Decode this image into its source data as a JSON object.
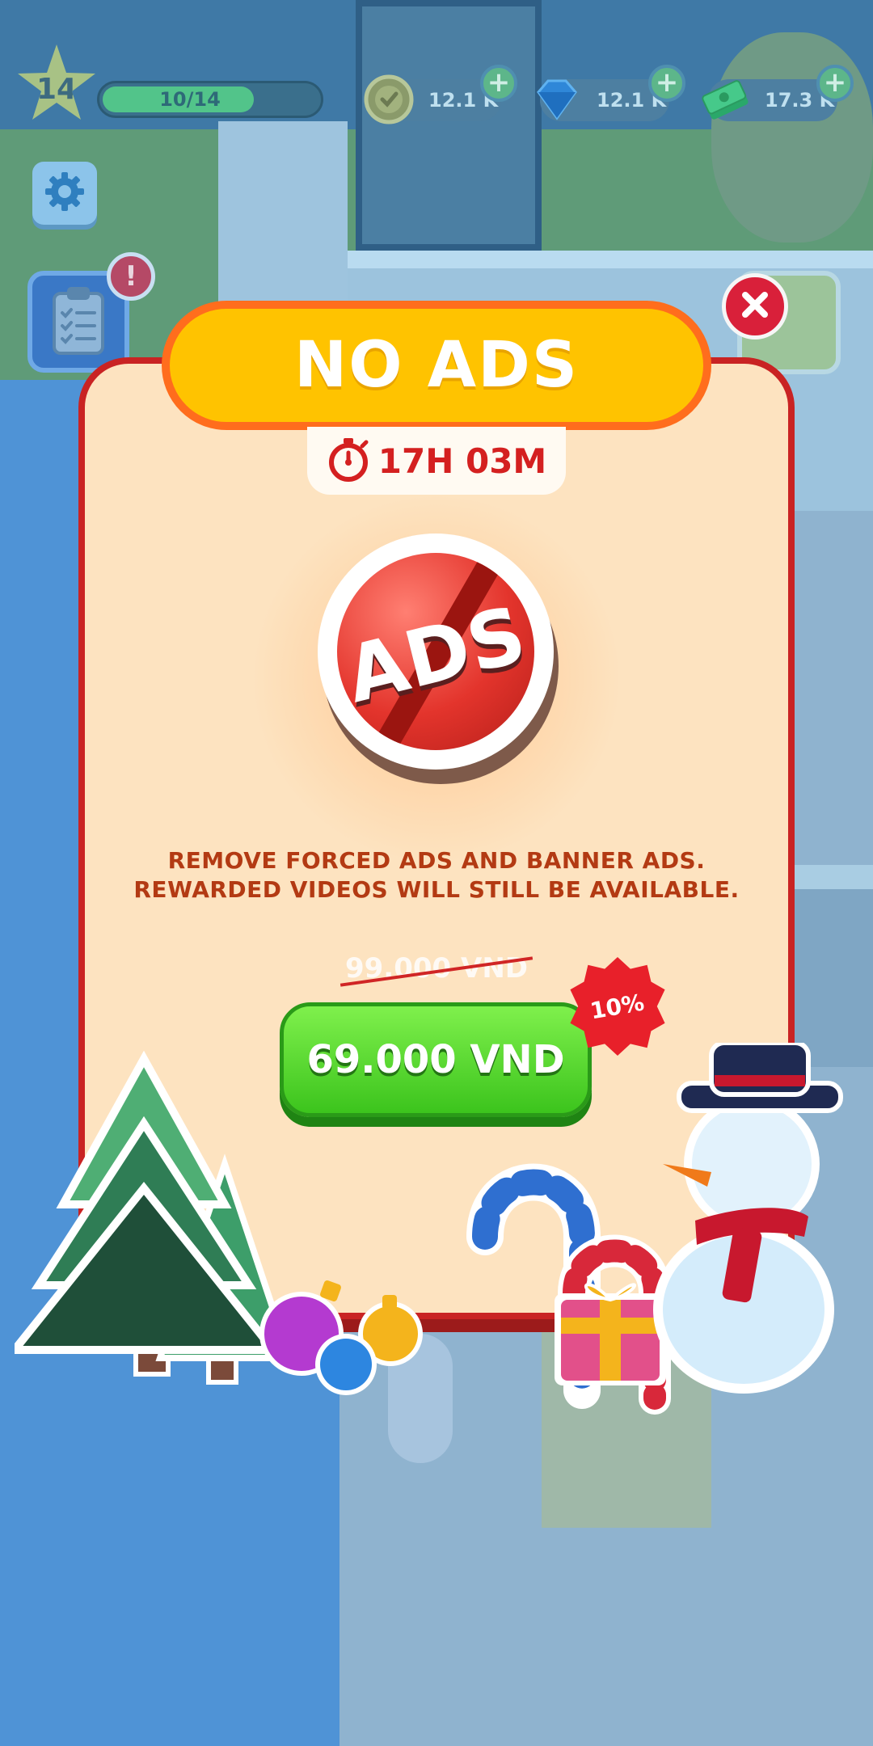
{
  "hud": {
    "level": "14",
    "xp_text": "10/14",
    "xp_progress": 0.71,
    "coins": "12.1 K",
    "gems": "12.1 K",
    "cash": "17.3 K",
    "plus_symbol": "+",
    "alert_symbol": "!"
  },
  "modal": {
    "title": "NO ADS",
    "timer": "17H 03M",
    "badge_text": "ADS",
    "description_line1": "REMOVE FORCED ADS AND BANNER ADS.",
    "description_line2": "REWARDED VIDEOS WILL STILL BE AVAILABLE.",
    "old_price": "99.000 VND",
    "price": "69.000 VND",
    "discount": "10%"
  },
  "colors": {
    "banner": "#ffc300",
    "modal_border": "#c92323",
    "modal_bg": "#fde3c0",
    "buy_button": "#3cc41d",
    "text_accent": "#b33a13"
  },
  "icons": [
    "settings-icon",
    "clipboard-icon",
    "close-icon",
    "stopwatch-icon",
    "coin-icon",
    "gem-icon",
    "cash-icon"
  ]
}
